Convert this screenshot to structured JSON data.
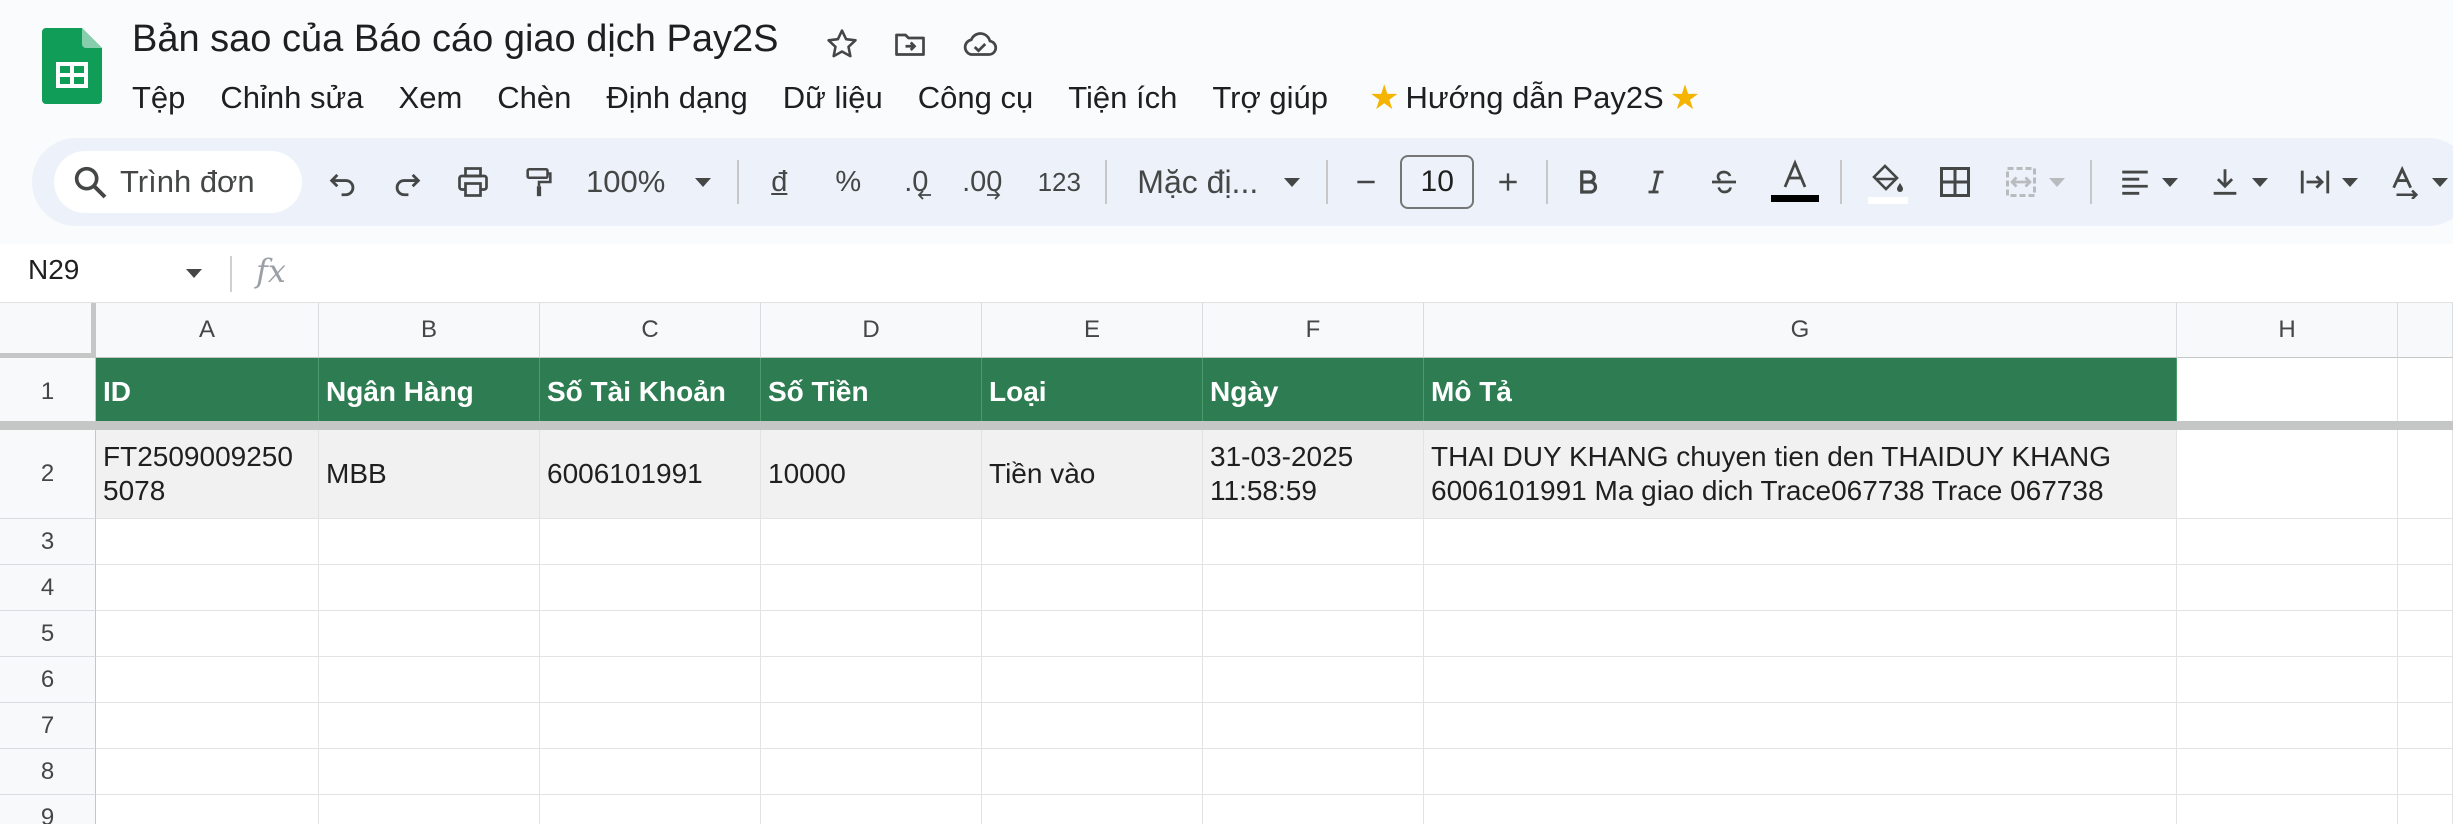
{
  "doc": {
    "title": "Bản sao của Báo cáo giao dịch Pay2S",
    "brand_color": "#0f9d58"
  },
  "title_icons": [
    "star-icon",
    "move-folder-icon",
    "cloud-saved-icon"
  ],
  "menu": {
    "items": [
      "Tệp",
      "Chỉnh sửa",
      "Xem",
      "Chèn",
      "Định dạng",
      "Dữ liệu",
      "Công cụ",
      "Tiện ích",
      "Trợ giúp"
    ],
    "guide_label": "Hướng dẫn Pay2S"
  },
  "toolbar": {
    "search_label": "Trình đơn",
    "zoom": "100%",
    "currency": "đ",
    "percent": "%",
    "decrease_decimal": ".0",
    "increase_decimal": ".00",
    "number_format": "123",
    "font_name": "Mặc đị...",
    "font_size": "10"
  },
  "formula_bar": {
    "cell_ref": "N29",
    "fx": "fx"
  },
  "sheet": {
    "header_color": "#2e7d52",
    "columns": [
      "A",
      "B",
      "C",
      "D",
      "E",
      "F",
      "G",
      "H"
    ],
    "rows": [
      "1",
      "2",
      "3",
      "4",
      "5",
      "6",
      "7",
      "8",
      "9"
    ],
    "header_row": [
      "ID",
      "Ngân Hàng",
      "Số Tài Khoản",
      "Số Tiền",
      "Loại",
      "Ngày",
      "Mô Tả"
    ],
    "data_row": [
      "FT2509009250\n5078",
      "MBB",
      "6006101991",
      "10000",
      "Tiền vào",
      "31-03-2025\n11:58:59",
      "THAI DUY KHANG chuyen tien den THAIDUY KHANG\n6006101991   Ma giao dich  Trace067738 Trace 067738"
    ]
  }
}
